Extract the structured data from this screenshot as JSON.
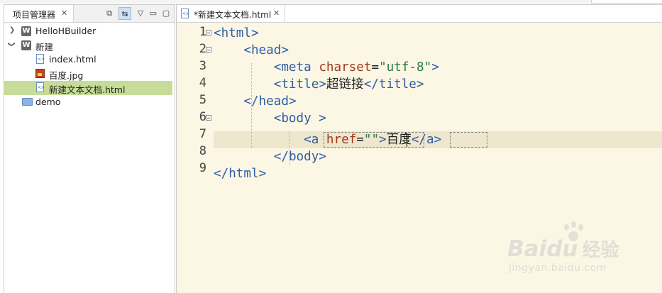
{
  "explorer": {
    "tab_label": "项目管理器",
    "close_glyph": "✕",
    "tools": {
      "collapse_glyph": "⧉",
      "link_glyph": "⇆",
      "menu_glyph": "▽",
      "minimize_glyph": "▭",
      "maximize_glyph": "▢"
    },
    "tree": [
      {
        "label": "HelloHBuilder",
        "expanded": false,
        "icon": "project-w-icon"
      },
      {
        "label": "新建",
        "expanded": true,
        "icon": "project-w-icon"
      },
      {
        "label": "index.html",
        "icon": "html-file-icon"
      },
      {
        "label": "百度.jpg",
        "icon": "jpg-file-icon"
      },
      {
        "label": "新建文本文档.html",
        "icon": "html-file-icon",
        "selected": true
      },
      {
        "label": "demo",
        "icon": "folder-icon"
      }
    ],
    "project_icon_letter": "W"
  },
  "editor": {
    "tab_label": "*新建文本文档.html",
    "close_glyph": "✕",
    "line_numbers": [
      "1",
      "2",
      "3",
      "4",
      "5",
      "6",
      "7",
      "8",
      "9"
    ],
    "code": {
      "l1": {
        "open": "<",
        "tag": "html",
        "close": ">"
      },
      "l2": {
        "indent": "    ",
        "open": "<",
        "tag": "head",
        "close": ">"
      },
      "l3": {
        "indent": "        ",
        "open": "<",
        "tag": "meta",
        "sp": " ",
        "attr": "charset",
        "eq": "=",
        "val": "\"utf-8\"",
        "close": ">"
      },
      "l4": {
        "indent": "        ",
        "open": "<",
        "tag": "title",
        "close": ">",
        "text": "超链接",
        "open2": "</",
        "tag2": "title",
        "close2": ">"
      },
      "l5": {
        "indent": "    ",
        "open": "</",
        "tag": "head",
        "close": ">"
      },
      "l6": {
        "indent": "        ",
        "open": "<",
        "tag": "body",
        "close": " >"
      },
      "l7": {
        "indent": "            ",
        "open": "<",
        "tag": "a",
        "sp": " ",
        "attr": "href",
        "eq": "=",
        "q1": "\"",
        "q2": "\"",
        "close": ">",
        "text": "百度",
        "open2": "</",
        "tag2": "a",
        "close2": ">"
      },
      "l8": {
        "indent": "        ",
        "open": "</",
        "tag": "body",
        "close": ">"
      },
      "l9": {
        "open": "</",
        "tag": "html",
        "close": ">"
      }
    }
  },
  "watermark": {
    "logo_text": "Bai",
    "logo_text2": "du",
    "jingyan": "经验",
    "url": "jingyan.baidu.com"
  }
}
